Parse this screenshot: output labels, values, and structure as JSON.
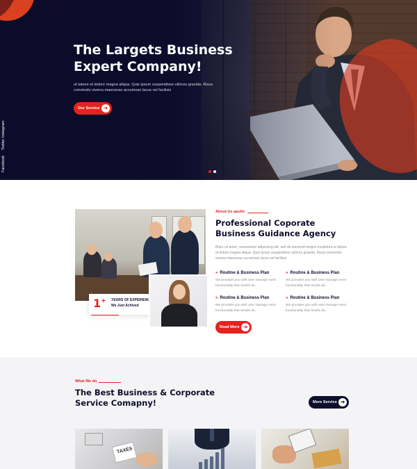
{
  "hero": {
    "title": "The Largets Business Expert Company!",
    "text": "ut labore et dolore magna aliqua. Quis ipsum suspendisse ultrices gravida. Risus commodo viverra maecenas accumsan lacus vel facilisis",
    "button_label": "Our Service",
    "social": [
      "Instagram",
      "Twitter",
      "Facebook"
    ],
    "slide_dots": 2,
    "active_slide": 1
  },
  "about": {
    "label": "About Us apollo",
    "title": "Professional Coporate Business Guidance Agency",
    "text": "Bolor sit amet, consectetur adipiscing elit, sed do eiusmod tempor incididunt ut labore et dolore magna aliqua. Quis ipsum suspendisse ultrices gravida. Risus commodo viverra maecenas accumsan lacus vel facilisis.",
    "experience": {
      "number": "1",
      "sup": "+",
      "line1": "YEARS OF EXPERIENCE",
      "line2": "We Just Achived"
    },
    "features": [
      {
        "title": "Routine & Business Plan",
        "text": "We provides you with user manage ment functionality that results de,"
      },
      {
        "title": "Routine & Business Plan",
        "text": "We provides you with user manage ment functionality that results de,"
      },
      {
        "title": "Routine & Business Plan",
        "text": "We provides you with user manage ment functionality that results de,"
      },
      {
        "title": "Routine & Business Plan",
        "text": "We provides you with user manage ment functionality that results de,"
      }
    ],
    "button_label": "Read More"
  },
  "services": {
    "label": "What We do",
    "title": "The Best Business & Corporate Service Comapny!",
    "button_label": "More Service",
    "card1_paper_text": "TAXES"
  },
  "colors": {
    "accent": "#e5231e",
    "navy": "#0e0f2c",
    "muted_text": "#8b8b96",
    "section_bg": "#f4f4f6"
  }
}
